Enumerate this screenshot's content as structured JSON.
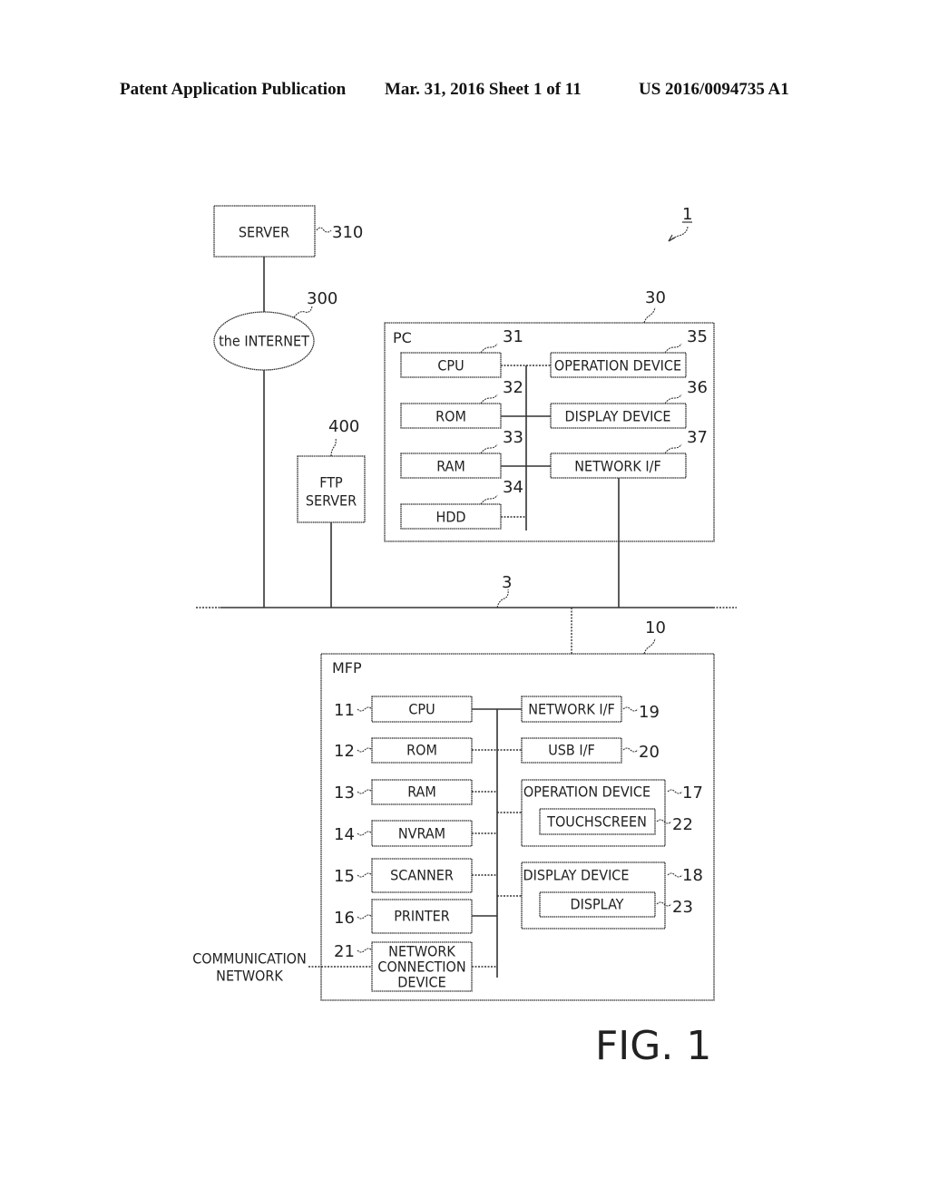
{
  "header": {
    "publication": "Patent Application Publication",
    "date_sheet": "Mar. 31, 2016  Sheet 1 of 11",
    "pub_number": "US 2016/0094735 A1"
  },
  "figure": {
    "label": "FIG. 1",
    "system_ref": "1",
    "network_ref": "3",
    "server": {
      "label": "SERVER",
      "ref": "310"
    },
    "internet": {
      "label": "the INTERNET",
      "ref": "300"
    },
    "ftp_server": {
      "label_line1": "FTP",
      "label_line2": "SERVER",
      "ref": "400"
    },
    "pc": {
      "label": "PC",
      "ref": "30",
      "cpu": {
        "label": "CPU",
        "ref": "31"
      },
      "rom": {
        "label": "ROM",
        "ref": "32"
      },
      "ram": {
        "label": "RAM",
        "ref": "33"
      },
      "hdd": {
        "label": "HDD",
        "ref": "34"
      },
      "operation_device": {
        "label": "OPERATION DEVICE",
        "ref": "35"
      },
      "display_device": {
        "label": "DISPLAY DEVICE",
        "ref": "36"
      },
      "network_if": {
        "label": "NETWORK I/F",
        "ref": "37"
      }
    },
    "mfp": {
      "label": "MFP",
      "ref": "10",
      "cpu": {
        "label": "CPU",
        "ref": "11"
      },
      "rom": {
        "label": "ROM",
        "ref": "12"
      },
      "ram": {
        "label": "RAM",
        "ref": "13"
      },
      "nvram": {
        "label": "NVRAM",
        "ref": "14"
      },
      "scanner": {
        "label": "SCANNER",
        "ref": "15"
      },
      "printer": {
        "label": "PRINTER",
        "ref": "16"
      },
      "network_connection_device": {
        "label_line1": "NETWORK",
        "label_line2": "CONNECTION",
        "label_line3": "DEVICE",
        "ref": "21"
      },
      "network_if": {
        "label": "NETWORK I/F",
        "ref": "19"
      },
      "usb_if": {
        "label": "USB I/F",
        "ref": "20"
      },
      "operation_device": {
        "label": "OPERATION DEVICE",
        "ref": "17"
      },
      "touchscreen": {
        "label": "TOUCHSCREEN",
        "ref": "22"
      },
      "display_device": {
        "label": "DISPLAY DEVICE",
        "ref": "18"
      },
      "display": {
        "label": "DISPLAY",
        "ref": "23"
      }
    },
    "communication_network": {
      "label_line1": "COMMUNICATION",
      "label_line2": "NETWORK"
    }
  }
}
